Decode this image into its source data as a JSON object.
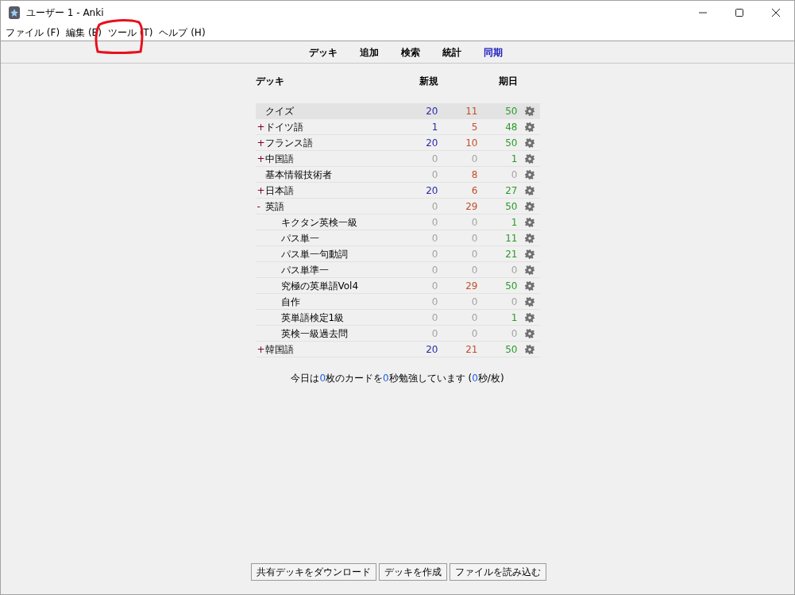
{
  "window": {
    "title": "ユーザー 1 - Anki"
  },
  "menu": [
    "ファイル (F)",
    "編集 (E)",
    "ツール (T)",
    "ヘルプ (H)"
  ],
  "toolbar": [
    {
      "label": "デッキ",
      "highlighted": false
    },
    {
      "label": "追加",
      "highlighted": false
    },
    {
      "label": "検索",
      "highlighted": false
    },
    {
      "label": "統計",
      "highlighted": false
    },
    {
      "label": "同期",
      "highlighted": true
    }
  ],
  "table": {
    "columns": [
      "デッキ",
      "新規",
      "期日"
    ],
    "rows": [
      {
        "name": "クイズ",
        "toggle": "",
        "selected": true,
        "counts": [
          {
            "text": "20",
            "dimmed": false
          },
          {
            "text": "11",
            "dimmed": false
          },
          {
            "text": "50",
            "dimmed": false
          }
        ]
      },
      {
        "name": "ドイツ語",
        "toggle": "+",
        "selected": false,
        "counts": [
          {
            "text": "1",
            "dimmed": false
          },
          {
            "text": "5",
            "dimmed": false
          },
          {
            "text": "48",
            "dimmed": false
          }
        ]
      },
      {
        "name": "フランス語",
        "toggle": "+",
        "selected": false,
        "counts": [
          {
            "text": "20",
            "dimmed": false
          },
          {
            "text": "10",
            "dimmed": false
          },
          {
            "text": "50",
            "dimmed": false
          }
        ]
      },
      {
        "name": "中国語",
        "toggle": "+",
        "selected": false,
        "counts": [
          {
            "text": "0",
            "dimmed": true
          },
          {
            "text": "0",
            "dimmed": true
          },
          {
            "text": "1",
            "dimmed": false
          }
        ]
      },
      {
        "name": "基本情報技術者",
        "toggle": "",
        "selected": false,
        "counts": [
          {
            "text": "0",
            "dimmed": true
          },
          {
            "text": "8",
            "dimmed": false
          },
          {
            "text": "0",
            "dimmed": true
          }
        ]
      },
      {
        "name": "日本語",
        "toggle": "+",
        "selected": false,
        "counts": [
          {
            "text": "20",
            "dimmed": false
          },
          {
            "text": "6",
            "dimmed": false
          },
          {
            "text": "27",
            "dimmed": false
          }
        ]
      },
      {
        "name": "英語",
        "toggle": "-",
        "selected": false,
        "counts": [
          {
            "text": "0",
            "dimmed": true
          },
          {
            "text": "29",
            "dimmed": false
          },
          {
            "text": "50",
            "dimmed": false
          }
        ],
        "children": [
          {
            "name": "キクタン英検一級",
            "selected": false,
            "counts": [
              {
                "text": "0",
                "dimmed": true
              },
              {
                "text": "0",
                "dimmed": true
              },
              {
                "text": "1",
                "dimmed": false
              }
            ]
          },
          {
            "name": "パス単一",
            "selected": false,
            "counts": [
              {
                "text": "0",
                "dimmed": true
              },
              {
                "text": "0",
                "dimmed": true
              },
              {
                "text": "11",
                "dimmed": false
              }
            ]
          },
          {
            "name": "パス単一句動詞",
            "selected": false,
            "counts": [
              {
                "text": "0",
                "dimmed": true
              },
              {
                "text": "0",
                "dimmed": true
              },
              {
                "text": "21",
                "dimmed": false
              }
            ]
          },
          {
            "name": "パス単準一",
            "selected": false,
            "counts": [
              {
                "text": "0",
                "dimmed": true
              },
              {
                "text": "0",
                "dimmed": true
              },
              {
                "text": "0",
                "dimmed": true
              }
            ]
          },
          {
            "name": "究極の英単語Vol4",
            "selected": false,
            "counts": [
              {
                "text": "0",
                "dimmed": true
              },
              {
                "text": "29",
                "dimmed": false
              },
              {
                "text": "50",
                "dimmed": false
              }
            ]
          },
          {
            "name": "自作",
            "selected": false,
            "counts": [
              {
                "text": "0",
                "dimmed": true
              },
              {
                "text": "0",
                "dimmed": true
              },
              {
                "text": "0",
                "dimmed": true
              }
            ]
          },
          {
            "name": "英単語検定1級",
            "selected": false,
            "counts": [
              {
                "text": "0",
                "dimmed": true
              },
              {
                "text": "0",
                "dimmed": true
              },
              {
                "text": "1",
                "dimmed": false
              }
            ]
          },
          {
            "name": "英検一級過去問",
            "selected": false,
            "counts": [
              {
                "text": "0",
                "dimmed": true
              },
              {
                "text": "0",
                "dimmed": true
              },
              {
                "text": "0",
                "dimmed": true
              }
            ]
          }
        ]
      },
      {
        "name": "韓国語",
        "toggle": "+",
        "selected": false,
        "counts": [
          {
            "text": "20",
            "dimmed": false
          },
          {
            "text": "21",
            "dimmed": false
          },
          {
            "text": "50",
            "dimmed": false
          }
        ]
      }
    ]
  },
  "summary": [
    {
      "text": "今日は",
      "kind": "plain"
    },
    {
      "text": "0",
      "kind": "number"
    },
    {
      "text": "枚のカードを",
      "kind": "plain"
    },
    {
      "text": "0",
      "kind": "number"
    },
    {
      "text": "秒勉強しています (",
      "kind": "plain"
    },
    {
      "text": "0",
      "kind": "number"
    },
    {
      "text": "秒/枚)",
      "kind": "plain"
    }
  ],
  "buttons": [
    "共有デッキをダウンロード",
    "デッキを作成",
    "ファイルを読み込む"
  ]
}
